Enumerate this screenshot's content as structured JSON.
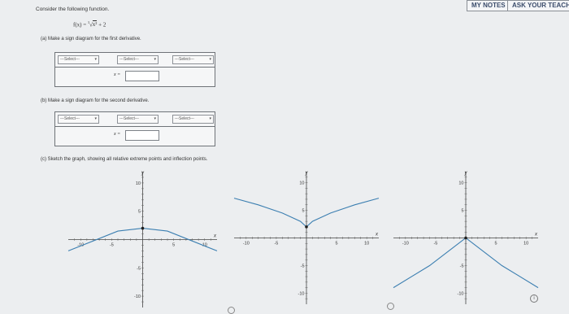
{
  "header": {
    "my_notes": "MY NOTES",
    "ask_teacher": "ASK YOUR TEACHE"
  },
  "question": {
    "intro": "Consider the following function.",
    "formula_lhs": "f(x) =",
    "formula_rhs": "+ 2",
    "formula_root": "√",
    "formula_radicand": "x²",
    "formula_index": "3"
  },
  "part_a": {
    "label": "(a)   Make a sign diagram for the first derivative.",
    "selects": [
      "---Select---",
      "---Select---",
      "---Select---"
    ],
    "x_label": "x =",
    "x_value": ""
  },
  "part_b": {
    "label": "(b)   Make a sign diagram for the second derivative.",
    "selects": [
      "---Select---",
      "---Select---",
      "---Select---"
    ],
    "x_label": "x =",
    "x_value": ""
  },
  "part_c": {
    "label": "(c)   Sketch the graph, showing all relative extreme points and inflection points."
  },
  "icons": {
    "chevron": "chevron-down-icon",
    "info": "info-icon"
  },
  "chart_data": [
    {
      "type": "line",
      "title": "",
      "xlabel": "x",
      "ylabel": "y",
      "xlim": [
        -12,
        12
      ],
      "ylim": [
        -12,
        12
      ],
      "xticks": [
        -10,
        -5,
        5,
        10
      ],
      "yticks": [
        -10,
        -5,
        5,
        10
      ],
      "series": [
        {
          "values": [
            [
              -12,
              -2
            ],
            [
              -4,
              1.5
            ],
            [
              0,
              2
            ],
            [
              4,
              1.5
            ],
            [
              12,
              -2
            ]
          ]
        }
      ],
      "points": [
        [
          0,
          2
        ]
      ]
    },
    {
      "type": "line",
      "title": "",
      "xlabel": "x",
      "ylabel": "y",
      "xlim": [
        -12,
        12
      ],
      "ylim": [
        -12,
        12
      ],
      "xticks": [
        -10,
        -5,
        5,
        10
      ],
      "yticks": [
        -10,
        -5,
        5,
        10
      ],
      "series": [
        {
          "values": [
            [
              -12,
              7.2
            ],
            [
              -8,
              6
            ],
            [
              -4,
              4.5
            ],
            [
              -1,
              3
            ],
            [
              0,
              2
            ],
            [
              1,
              3
            ],
            [
              4,
              4.5
            ],
            [
              8,
              6
            ],
            [
              12,
              7.2
            ]
          ]
        }
      ],
      "points": [
        [
          0,
          2
        ]
      ]
    },
    {
      "type": "line",
      "title": "",
      "xlabel": "x",
      "ylabel": "y",
      "xlim": [
        -12,
        12
      ],
      "ylim": [
        -12,
        12
      ],
      "xticks": [
        -10,
        -5,
        5,
        10
      ],
      "yticks": [
        -10,
        -5,
        5,
        10
      ],
      "series": [
        {
          "values": [
            [
              -12,
              -9
            ],
            [
              -6,
              -5
            ],
            [
              0,
              0
            ],
            [
              6,
              -5
            ],
            [
              12,
              -9
            ]
          ]
        }
      ],
      "points": [
        [
          0,
          0
        ]
      ]
    }
  ]
}
